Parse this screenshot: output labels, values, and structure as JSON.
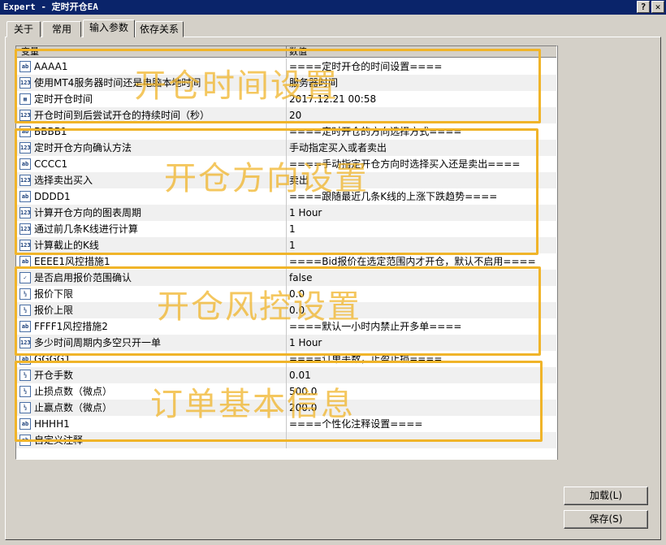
{
  "window": {
    "title": "Expert - 定时开仓EA",
    "help_label": "?",
    "close_label": "✕"
  },
  "tabs": [
    {
      "label": "关于"
    },
    {
      "label": "常用"
    },
    {
      "label": "输入参数"
    },
    {
      "label": "依存关系"
    }
  ],
  "grid": {
    "col_variable": "变量",
    "col_value": "数值",
    "rows": [
      {
        "icon": "ab",
        "name": "AAAA1",
        "value": "====定时开仓的时间设置===="
      },
      {
        "icon": "123",
        "name": "使用MT4服务器时间还是电脑本地时间",
        "value": "服务器时间"
      },
      {
        "icon": "dt",
        "name": "定时开仓时间",
        "value": "2017.12.21 00:58"
      },
      {
        "icon": "123",
        "name": "开仓时间到后尝试开仓的持续时间（秒）",
        "value": "20"
      },
      {
        "icon": "ab",
        "name": "BBBB1",
        "value": "====定时开仓的方向选择方式===="
      },
      {
        "icon": "123",
        "name": "定时开仓方向确认方法",
        "value": "手动指定买入或者卖出"
      },
      {
        "icon": "ab",
        "name": "CCCC1",
        "value": "====手动指定开仓方向时选择买入还是卖出===="
      },
      {
        "icon": "123",
        "name": "选择卖出买入",
        "value": "卖出"
      },
      {
        "icon": "ab",
        "name": "DDDD1",
        "value": "====跟随最近几条K线的上涨下跌趋势===="
      },
      {
        "icon": "123",
        "name": "计算开仓方向的图表周期",
        "value": "1 Hour"
      },
      {
        "icon": "123",
        "name": "通过前几条K线进行计算",
        "value": "1"
      },
      {
        "icon": "123",
        "name": "计算截止的K线",
        "value": "1"
      },
      {
        "icon": "ab",
        "name": "EEEE1风控措施1",
        "value": "====Bid报价在选定范围内才开仓，默认不启用===="
      },
      {
        "icon": "tf",
        "name": "是否启用报价范围确认",
        "value": "false"
      },
      {
        "icon": "v2",
        "name": "报价下限",
        "value": "0.0"
      },
      {
        "icon": "v2",
        "name": "报价上限",
        "value": "0.0"
      },
      {
        "icon": "ab",
        "name": "FFFF1风控措施2",
        "value": "====默认一小时内禁止开多单===="
      },
      {
        "icon": "123",
        "name": "多少时间周期内多空只开一单",
        "value": "1 Hour"
      },
      {
        "icon": "ab",
        "name": "GGGG1",
        "value": "====订单手数，止盈止损===="
      },
      {
        "icon": "v2",
        "name": "开仓手数",
        "value": "0.01"
      },
      {
        "icon": "v2",
        "name": "止损点数（微点）",
        "value": "500.0"
      },
      {
        "icon": "v2",
        "name": "止赢点数（微点）",
        "value": "200.0"
      },
      {
        "icon": "ab",
        "name": "HHHH1",
        "value": "====个性化注释设置===="
      },
      {
        "icon": "ab",
        "name": "自定义注释",
        "value": ""
      }
    ]
  },
  "overlays": [
    {
      "label": "开仓时间设置"
    },
    {
      "label": "开仓方向设置"
    },
    {
      "label": "开仓风控设置"
    },
    {
      "label": "订单基本信息"
    }
  ],
  "buttons": {
    "load_label": "加载(L)",
    "save_label": "保存(S)"
  },
  "colors": {
    "title_bar": "#0a246a",
    "overlay": "#f0b429",
    "window_bg": "#d4d0c8"
  }
}
